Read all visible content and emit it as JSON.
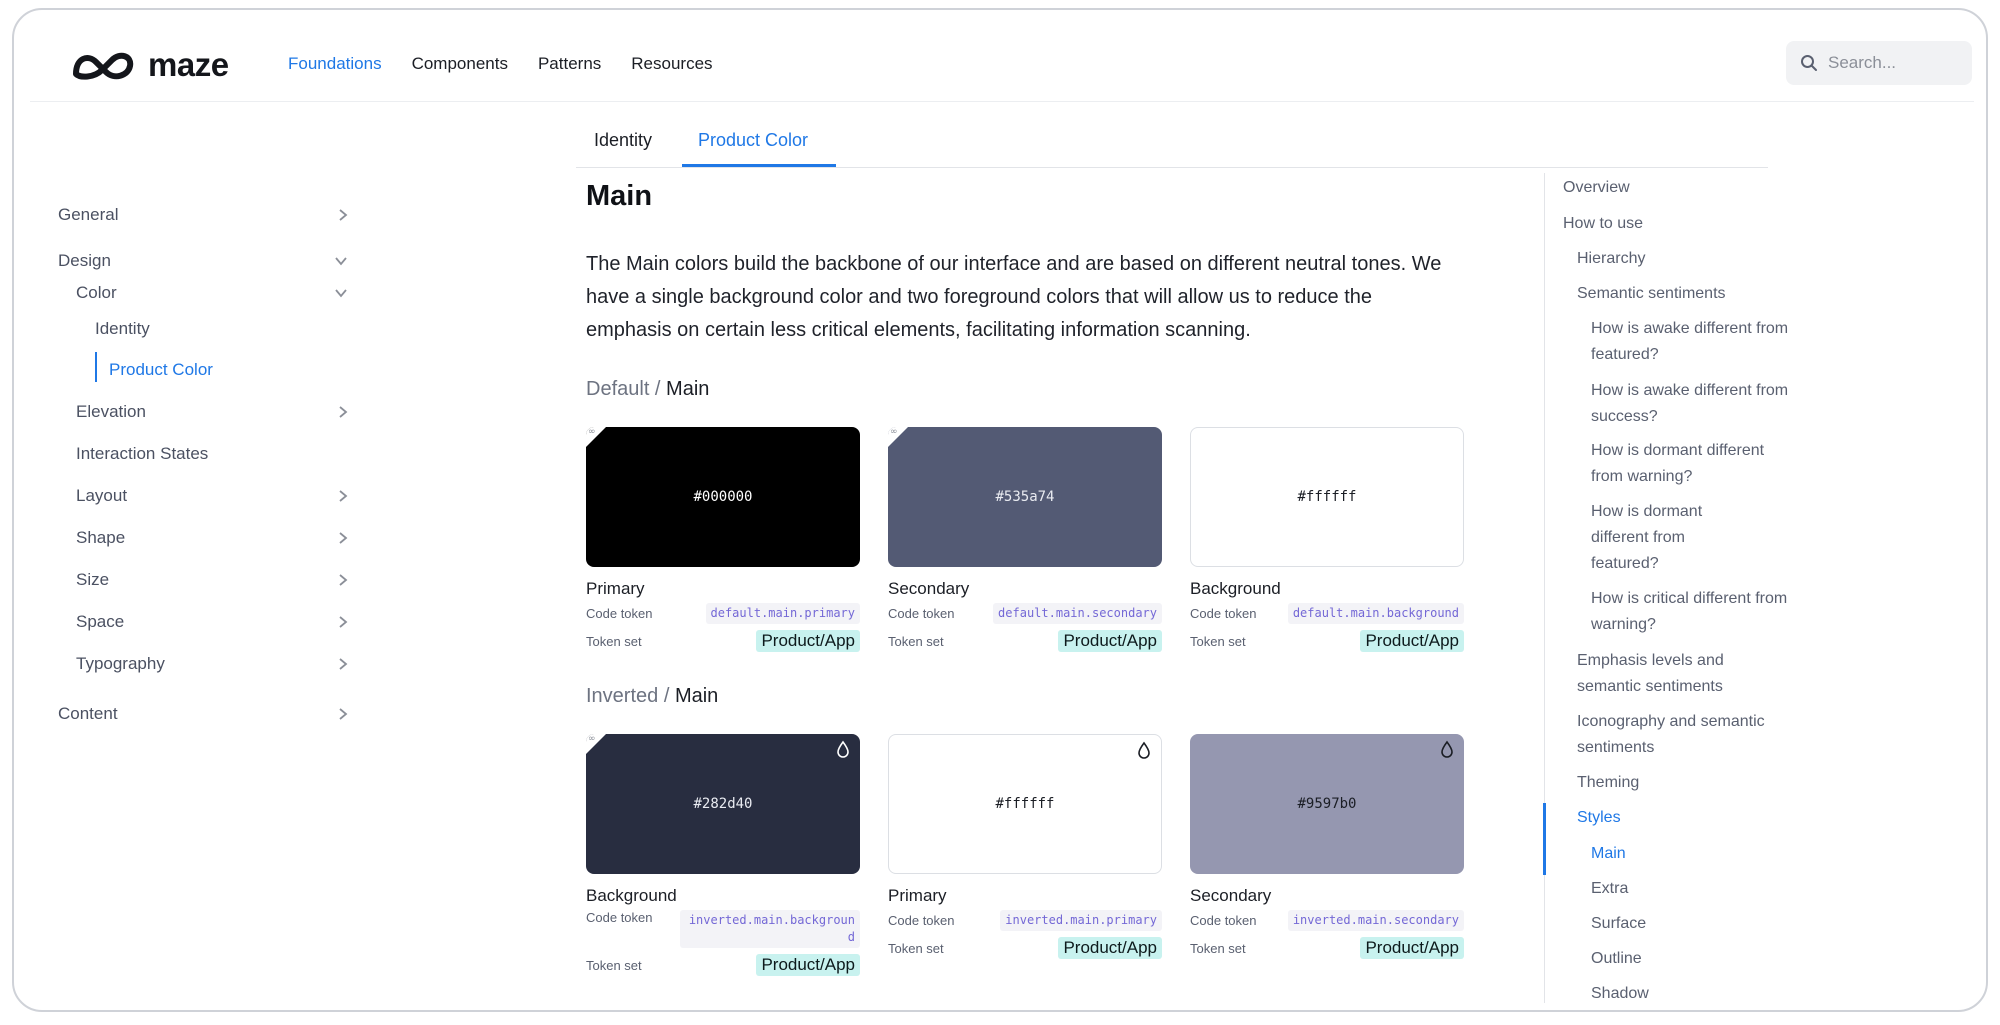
{
  "brand": {
    "name": "maze"
  },
  "topnav": {
    "items": [
      "Foundations",
      "Components",
      "Patterns",
      "Resources"
    ],
    "active": "Foundations"
  },
  "search": {
    "placeholder": "Search..."
  },
  "sidebar": {
    "items": [
      {
        "label": "General"
      },
      {
        "label": "Design"
      },
      {
        "label": "Color"
      },
      {
        "label": "Identity"
      },
      {
        "label": "Product Color"
      },
      {
        "label": "Elevation"
      },
      {
        "label": "Interaction States"
      },
      {
        "label": "Layout"
      },
      {
        "label": "Shape"
      },
      {
        "label": "Size"
      },
      {
        "label": "Space"
      },
      {
        "label": "Typography"
      },
      {
        "label": "Content"
      }
    ],
    "active": "Product Color"
  },
  "tabs": {
    "items": [
      "Identity",
      "Product Color"
    ],
    "active": "Product Color"
  },
  "main": {
    "title": "Main",
    "intro": "The Main colors build the backbone of our interface and are based on different neutral tones. We have a single background color and two foreground colors that will allow us to reduce the emphasis on certain less critical elements, facilitating information scanning.",
    "sections": [
      {
        "prefix": "Default /",
        "name": "Main",
        "cards": [
          {
            "hex": "#000000",
            "name": "Primary",
            "code_label": "Code token",
            "code": "default.main.primary",
            "set_label": "Token set",
            "set": "Product/App",
            "bg": "#000000",
            "fg": "#ffffff"
          },
          {
            "hex": "#535a74",
            "name": "Secondary",
            "code_label": "Code token",
            "code": "default.main.secondary",
            "set_label": "Token set",
            "set": "Product/App",
            "bg": "#535a74",
            "fg": "#ffffff"
          },
          {
            "hex": "#ffffff",
            "name": "Background",
            "code_label": "Code token",
            "code": "default.main.background",
            "set_label": "Token set",
            "set": "Product/App",
            "bg": "#ffffff",
            "fg": "#1b1e25"
          }
        ]
      },
      {
        "prefix": "Inverted /",
        "name": "Main",
        "cards": [
          {
            "hex": "#282d40",
            "name": "Background",
            "code_label": "Code token",
            "code": "inverted.main.background",
            "set_label": "Token set",
            "set": "Product/App",
            "bg": "#282d40",
            "fg": "#ffffff"
          },
          {
            "hex": "#ffffff",
            "name": "Primary",
            "code_label": "Code token",
            "code": "inverted.main.primary",
            "set_label": "Token set",
            "set": "Product/App",
            "bg": "#ffffff",
            "fg": "#1b1e25"
          },
          {
            "hex": "#9597b0",
            "name": "Secondary",
            "code_label": "Code token",
            "code": "inverted.main.secondary",
            "set_label": "Token set",
            "set": "Product/App",
            "bg": "#9597b0",
            "fg": "#1b1e25"
          }
        ]
      }
    ]
  },
  "toc": {
    "items": [
      {
        "label": "Overview"
      },
      {
        "label": "How to use"
      },
      {
        "label": "Hierarchy"
      },
      {
        "label": "Semantic sentiments"
      },
      {
        "label": "How is awake different from featured?"
      },
      {
        "label": "How is awake different from success?"
      },
      {
        "label": "How is dormant different from warning?"
      },
      {
        "label": "How is dormant different from featured?"
      },
      {
        "label": "How is critical different from warning?"
      },
      {
        "label": "Emphasis levels and semantic sentiments"
      },
      {
        "label": "Iconography and semantic sentiments"
      },
      {
        "label": "Theming"
      },
      {
        "label": "Styles"
      },
      {
        "label": "Main"
      },
      {
        "label": "Extra"
      },
      {
        "label": "Surface"
      },
      {
        "label": "Outline"
      },
      {
        "label": "Shadow"
      }
    ],
    "active": [
      "Styles",
      "Main"
    ]
  },
  "colors": {
    "accent": "#1f78e6",
    "token_set_bg": "#c8f2ef",
    "code_token_fg": "#7468d6"
  }
}
